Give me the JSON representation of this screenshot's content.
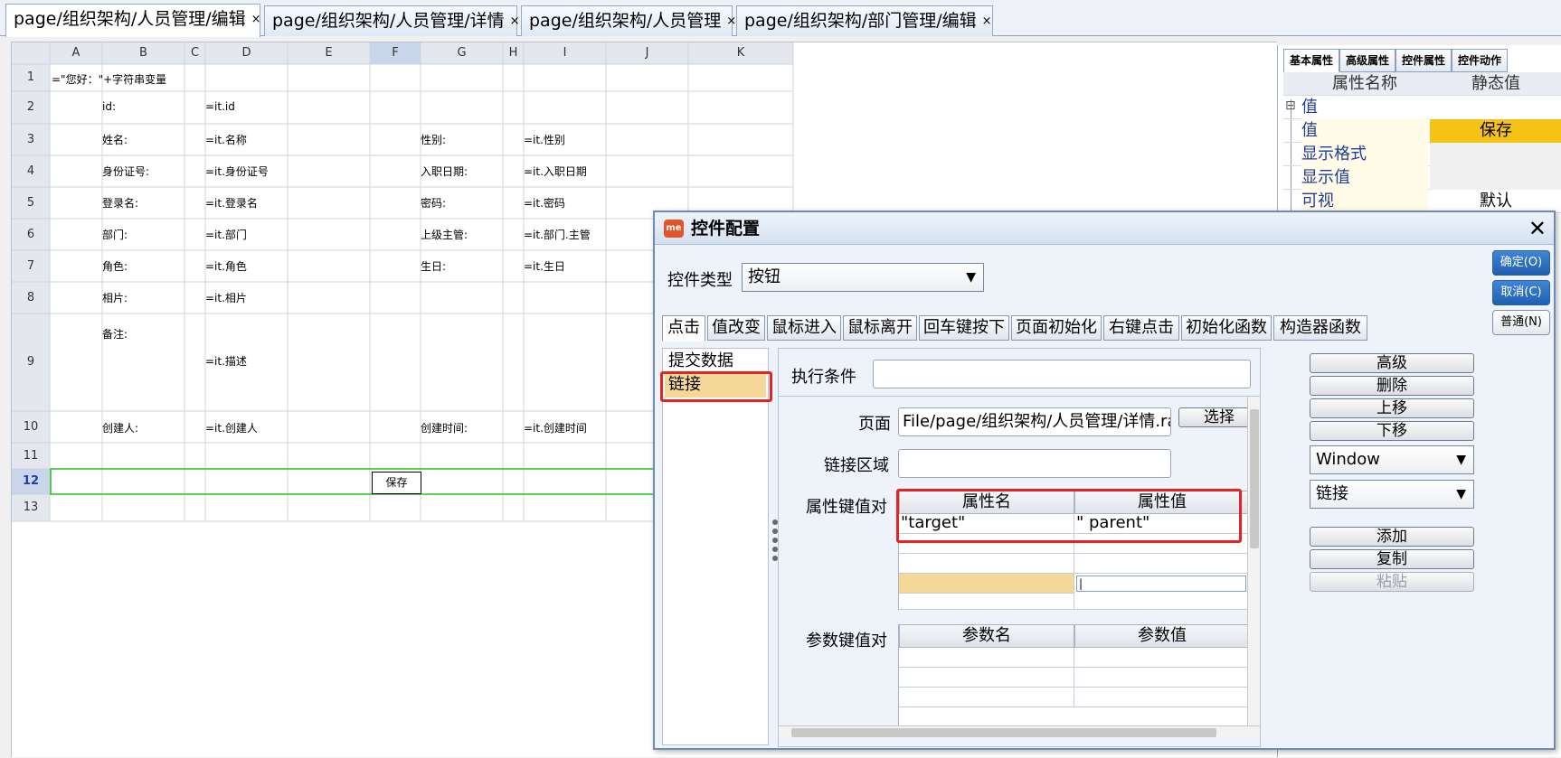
{
  "tabs": [
    {
      "label": "page/组织架构/人员管理/编辑",
      "close": "×"
    },
    {
      "label": "page/组织架构/人员管理/详情",
      "close": "×"
    },
    {
      "label": "page/组织架构/人员管理",
      "close": "×"
    },
    {
      "label": "page/组织架构/部门管理/编辑",
      "close": "×"
    }
  ],
  "sheet": {
    "columns": [
      "A",
      "B",
      "C",
      "D",
      "E",
      "F",
      "G",
      "H",
      "I",
      "J",
      "K"
    ],
    "rows": [
      "1",
      "2",
      "3",
      "4",
      "5",
      "6",
      "7",
      "8",
      "9",
      "10",
      "11",
      "12",
      "13"
    ],
    "cells": {
      "r1": "=\"您好：\"+字符串变量",
      "r2_label": "id:",
      "r2_value": "=it.id",
      "r3_label": "姓名:",
      "r3_value": "=it.名称",
      "r3_label2": "性别:",
      "r3_value2": "=it.性别",
      "r4_label": "身份证号:",
      "r4_value": "=it.身份证号",
      "r4_label2": "入职日期:",
      "r4_value2": "=it.入职日期",
      "r5_label": "登录名:",
      "r5_value": "=it.登录名",
      "r5_label2": "密码:",
      "r5_value2": "=it.密码",
      "r6_label": "部门:",
      "r6_value": "=it.部门",
      "r6_label2": "上级主管:",
      "r6_value2": "=it.部门.主管",
      "r7_label": "角色:",
      "r7_value": "=it.角色",
      "r7_label2": "生日:",
      "r7_value2": "=it.生日",
      "r8_label": "相片:",
      "r8_value": "=it.相片",
      "r9_label": "备注:",
      "r9_value": "=it.描述",
      "r10_label": "创建人:",
      "r10_value": "=it.创建人",
      "r10_label2": "创建时间:",
      "r10_value2": "=it.创建时间",
      "r12_button": "保存"
    }
  },
  "props": {
    "tabs": [
      "基本属性",
      "高级属性",
      "控件属性",
      "控件动作"
    ],
    "header": {
      "name": "属性名称",
      "value": "静态值"
    },
    "rows": [
      {
        "key": "值",
        "value": ""
      },
      {
        "key": "值",
        "value": "保存"
      },
      {
        "key": "显示格式",
        "value": ""
      },
      {
        "key": "显示值",
        "value": ""
      },
      {
        "key": "可视",
        "value": "默认"
      }
    ],
    "expand_icon": "⊟",
    "highlight_color": "#f5c216"
  },
  "dialog": {
    "title": "控件配置",
    "logo": "me",
    "close": "✕",
    "control_type_label": "控件类型",
    "control_type_value": "按钮",
    "buttons": {
      "ok": "确定(O)",
      "cancel": "取消(C)",
      "normal": "普通(N)"
    },
    "event_tabs": [
      "点击",
      "值改变",
      "鼠标进入",
      "鼠标离开",
      "回车键按下",
      "页面初始化",
      "右键点击",
      "初始化函数",
      "构造器函数"
    ],
    "actions": [
      "提交数据",
      "链接"
    ],
    "exec_condition_label": "执行条件",
    "exec_condition_value": "",
    "page_label": "页面",
    "page_value": "File/page/组织架构/人员管理/详情.raq",
    "select_button": "选择",
    "link_area_label": "链接区域",
    "link_area_value": "",
    "attr_pairs_label": "属性键值对",
    "attr_table": {
      "headers": [
        "属性名",
        "属性值"
      ],
      "rows": [
        [
          "\"target\"",
          "\" parent\""
        ],
        [
          "",
          ""
        ],
        [
          "",
          ""
        ],
        [
          "",
          "|"
        ],
        [
          "",
          ""
        ],
        [
          "",
          ""
        ]
      ]
    },
    "param_pairs_label": "参数键值对",
    "param_table": {
      "headers": [
        "参数名",
        "参数值"
      ]
    },
    "side_buttons": [
      "高级",
      "删除",
      "上移",
      "下移"
    ],
    "window_select": "Window",
    "link_select": "链接",
    "side_buttons2": [
      "添加",
      "复制",
      "粘贴"
    ],
    "accent_blue": "#2f6fc0",
    "highlight_red": "#e62222",
    "selected_row": "#f5d79a"
  }
}
